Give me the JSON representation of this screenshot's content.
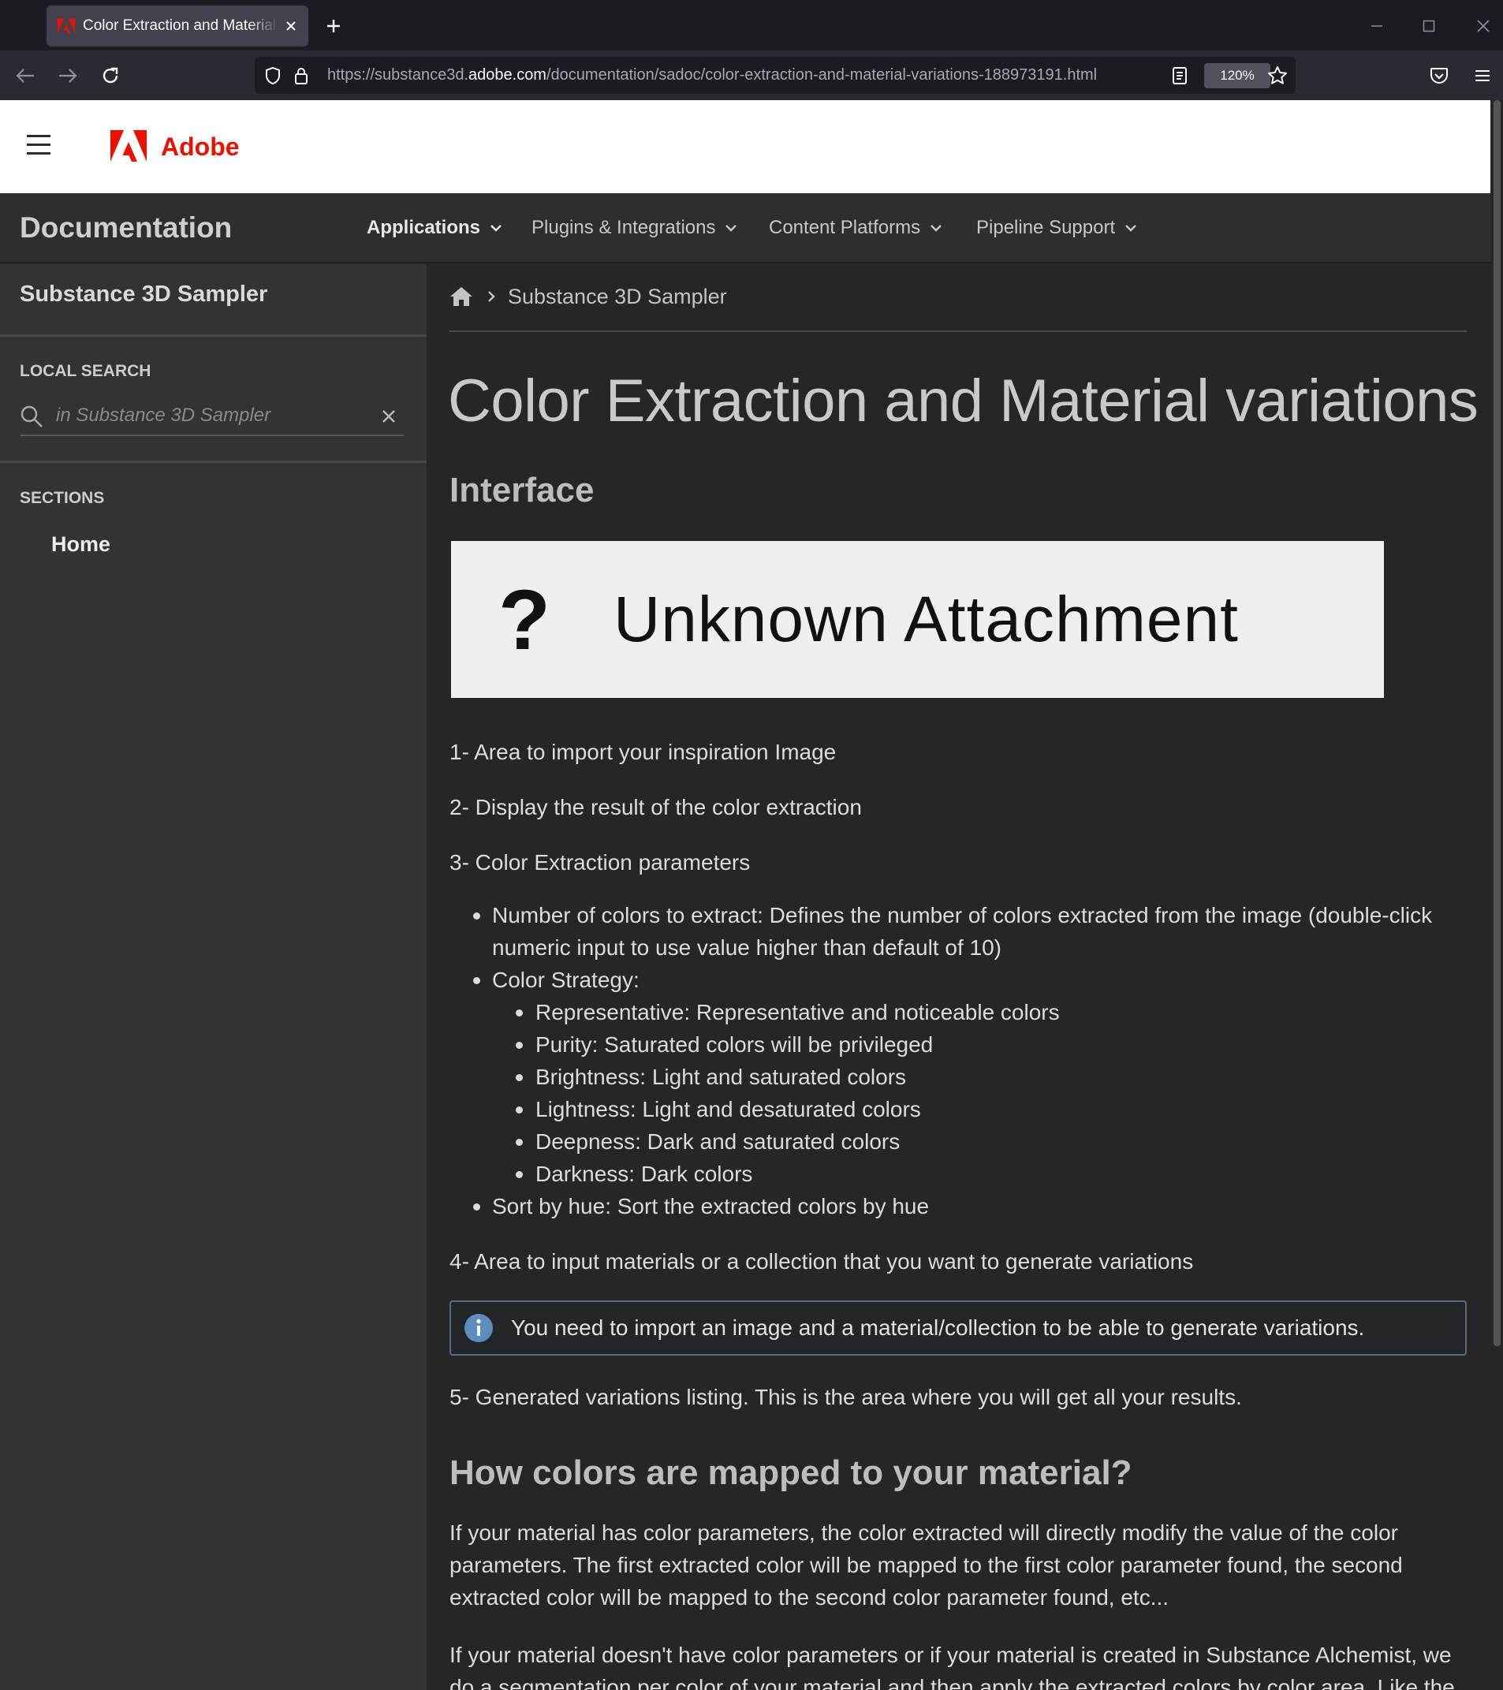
{
  "browser": {
    "tab_title": "Color Extraction and Material variations",
    "url_prefix": "https://substance3d.",
    "url_domain": "adobe.com",
    "url_path": "/documentation/sadoc/color-extraction-and-material-variations-188973191.html",
    "zoom": "120%"
  },
  "header": {
    "brand": "Adobe",
    "brand_color": "#eb1000"
  },
  "docbar": {
    "title": "Documentation",
    "nav": [
      "Applications",
      "Plugins & Integrations",
      "Content Platforms",
      "Pipeline Support"
    ]
  },
  "sidebar": {
    "title": "Substance 3D Sampler",
    "local_search_label": "LOCAL SEARCH",
    "search_placeholder": "in Substance 3D Sampler",
    "sections_label": "SECTIONS",
    "home": "Home"
  },
  "main": {
    "breadcrumb": "Substance 3D Sampler",
    "title": "Color Extraction and Material variations",
    "h_interface": "Interface",
    "attachment_text": "Unknown Attachment",
    "attachment_mark": "?",
    "item1": "1- Area to import your inspiration Image",
    "item2": "2- Display the result of the color extraction",
    "item3": "3- Color Extraction parameters",
    "bullets": {
      "num_colors": "Number of colors to extract: Defines the number of colors extracted from the image (double-click numeric input to use value higher than default of 10)",
      "color_strategy": "Color Strategy:",
      "strategies": [
        "Representative: Representative and noticeable colors",
        "Purity: Saturated colors will be privileged",
        "Brightness: Light and saturated colors",
        "Lightness: Light and desaturated colors",
        "Deepness: Dark and saturated colors",
        "Darkness: Dark colors"
      ],
      "sort_by_hue": "Sort by hue: Sort the extracted colors by hue"
    },
    "item4": "4- Area to input materials or a collection that you want to generate variations",
    "info": "You need to import an image and a material/collection to be able to generate variations.",
    "item5": "5- Generated variations listing. This is the area where you will get all your results.",
    "h_mapping": "How colors are mapped to your material?",
    "para1": "If your material has color parameters, the color extracted will directly modify the value of the color parameters. The first extracted color will be mapped to the first color parameter found, the second extracted color will be mapped to the second color parameter found, etc...",
    "para2": "If your material doesn't have color parameters or if your material is created in Substance Alchemist, we do a segmentation per color of your material and then apply the extracted colors by color area. Like the previous"
  }
}
